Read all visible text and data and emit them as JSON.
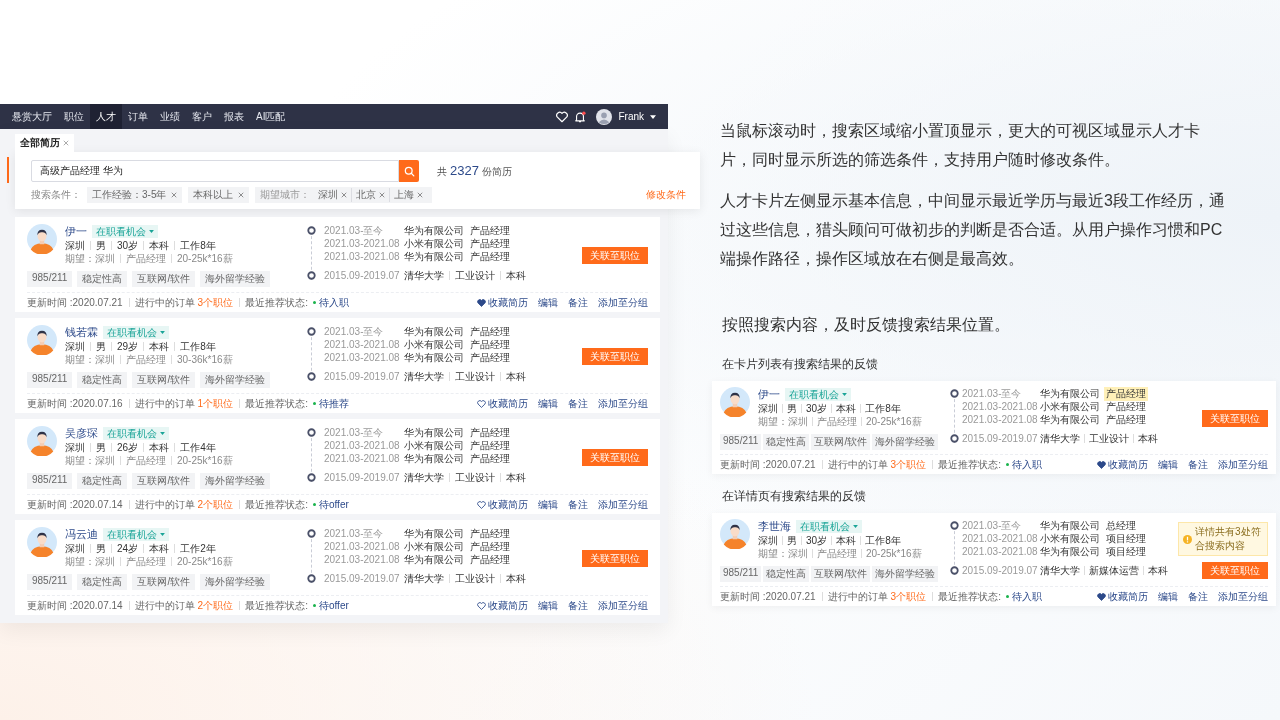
{
  "nav": {
    "items": [
      {
        "label": "悬赏大厅",
        "selected": false
      },
      {
        "label": "职位",
        "selected": false
      },
      {
        "label": "人才",
        "selected": true
      },
      {
        "label": "订单",
        "selected": false
      },
      {
        "label": "业绩",
        "selected": false
      },
      {
        "label": "客户",
        "selected": false
      },
      {
        "label": "报表",
        "selected": false
      },
      {
        "label": "AI匹配",
        "selected": false
      }
    ],
    "user": "Frank",
    "notification": true
  },
  "tabs": [
    {
      "label": "全部简历",
      "selected": true
    }
  ],
  "search": {
    "value": "高级产品经理 华为",
    "total_prefix": "共",
    "total": "2327",
    "total_suffix": "份简历",
    "conditions_label": "搜索条件：",
    "conditions": [
      {
        "kind": "chip",
        "label": "工作经验：3-5年"
      },
      {
        "kind": "chip",
        "label": "本科以上"
      },
      {
        "kind": "group",
        "label": "期望城市：",
        "values": [
          "深圳",
          "北京",
          "上海"
        ]
      }
    ],
    "modify": "修改条件"
  },
  "cards": [
    {
      "name": "伊一",
      "status": "在职看机会",
      "details": [
        "深圳",
        "男",
        "30岁",
        "本科",
        "工作8年"
      ],
      "expect_label": "期望：",
      "expect": [
        "深圳",
        "产品经理",
        "20-25k*16薪"
      ],
      "tags": [
        "985/211",
        "稳定性高",
        "互联网/软件",
        "海外留学经验"
      ],
      "jobs": [
        {
          "period": "2021.03-至今",
          "company": "华为有限公司",
          "title": "产品经理",
          "highlighted": false
        },
        {
          "period": "2021.03-2021.08",
          "company": "小米有限公司",
          "title": "产品经理",
          "highlighted": false
        },
        {
          "period": "2021.03-2021.08",
          "company": "华为有限公司",
          "title": "产品经理",
          "highlighted": false
        }
      ],
      "education": {
        "period": "2015.09-2019.07",
        "items": [
          "清华大学",
          "工业设计",
          "本科"
        ]
      },
      "action": "关联至职位",
      "updated": "更新时间 :2020.07.21",
      "orders_label": "进行中的订单",
      "orders": "3个职位",
      "recommend_label": "最近推荐状态:",
      "recommend": "待入职",
      "favorited": true,
      "links": [
        "收藏简历",
        "编辑",
        "备注",
        "添加至分组"
      ]
    },
    {
      "name": "钱若霖",
      "status": "在职看机会",
      "details": [
        "深圳",
        "男",
        "29岁",
        "本科",
        "工作8年"
      ],
      "expect_label": "期望：",
      "expect": [
        "深圳",
        "产品经理",
        "30-36k*16薪"
      ],
      "tags": [
        "985/211",
        "稳定性高",
        "互联网/软件",
        "海外留学经验"
      ],
      "jobs": [
        {
          "period": "2021.03-至今",
          "company": "华为有限公司",
          "title": "产品经理",
          "highlighted": false
        },
        {
          "period": "2021.03-2021.08",
          "company": "小米有限公司",
          "title": "产品经理",
          "highlighted": false
        },
        {
          "period": "2021.03-2021.08",
          "company": "华为有限公司",
          "title": "产品经理",
          "highlighted": false
        }
      ],
      "education": {
        "period": "2015.09-2019.07",
        "items": [
          "清华大学",
          "工业设计",
          "本科"
        ]
      },
      "action": "关联至职位",
      "updated": "更新时间 :2020.07.16",
      "orders_label": "进行中的订单",
      "orders": "1个职位",
      "recommend_label": "最近推荐状态:",
      "recommend": "待推荐",
      "favorited": false,
      "links": [
        "收藏简历",
        "编辑",
        "备注",
        "添加至分组"
      ]
    },
    {
      "name": "吴彦琛",
      "status": "在职看机会",
      "details": [
        "深圳",
        "男",
        "26岁",
        "本科",
        "工作4年"
      ],
      "expect_label": "期望：",
      "expect": [
        "深圳",
        "产品经理",
        "20-25k*16薪"
      ],
      "tags": [
        "985/211",
        "稳定性高",
        "互联网/软件",
        "海外留学经验"
      ],
      "jobs": [
        {
          "period": "2021.03-至今",
          "company": "华为有限公司",
          "title": "产品经理",
          "highlighted": false
        },
        {
          "period": "2021.03-2021.08",
          "company": "小米有限公司",
          "title": "产品经理",
          "highlighted": false
        },
        {
          "period": "2021.03-2021.08",
          "company": "华为有限公司",
          "title": "产品经理",
          "highlighted": false
        }
      ],
      "education": {
        "period": "2015.09-2019.07",
        "items": [
          "清华大学",
          "工业设计",
          "本科"
        ]
      },
      "action": "关联至职位",
      "updated": "更新时间 :2020.07.14",
      "orders_label": "进行中的订单",
      "orders": "2个职位",
      "recommend_label": "最近推荐状态:",
      "recommend": "待offer",
      "favorited": false,
      "links": [
        "收藏简历",
        "编辑",
        "备注",
        "添加至分组"
      ]
    },
    {
      "name": "冯云迪",
      "status": "在职看机会",
      "details": [
        "深圳",
        "男",
        "24岁",
        "本科",
        "工作2年"
      ],
      "expect_label": "期望：",
      "expect": [
        "深圳",
        "产品经理",
        "20-25k*16薪"
      ],
      "tags": [
        "985/211",
        "稳定性高",
        "互联网/软件",
        "海外留学经验"
      ],
      "jobs": [
        {
          "period": "2021.03-至今",
          "company": "华为有限公司",
          "title": "产品经理",
          "highlighted": false
        },
        {
          "period": "2021.03-2021.08",
          "company": "小米有限公司",
          "title": "产品经理",
          "highlighted": false
        },
        {
          "period": "2021.03-2021.08",
          "company": "华为有限公司",
          "title": "产品经理",
          "highlighted": false
        }
      ],
      "education": {
        "period": "2015.09-2019.07",
        "items": [
          "清华大学",
          "工业设计",
          "本科"
        ]
      },
      "action": "关联至职位",
      "updated": "更新时间 :2020.07.14",
      "orders_label": "进行中的订单",
      "orders": "2个职位",
      "recommend_label": "最近推荐状态:",
      "recommend": "待offer",
      "favorited": false,
      "links": [
        "收藏简历",
        "编辑",
        "备注",
        "添加至分组"
      ]
    }
  ],
  "description": [
    "当鼠标滚动时，搜索区域缩小置顶显示，更大的可视区域显示人才卡片，同时显示所选的筛选条件，支持用户随时修改条件。",
    "人才卡片左侧显示基本信息，中间显示最近学历与最近3段工作经历，通过这些信息，猎头顾问可做初步的判断是否合适。从用户操作习惯和PC端操作路径，操作区域放在右侧是最高效。"
  ],
  "feedback": {
    "heading": "按照搜索内容，及时反馈搜索结果位置。",
    "examples": [
      {
        "label": "在卡片列表有搜索结果的反馈",
        "card": {
          "name": "伊一",
          "status": "在职看机会",
          "details": [
            "深圳",
            "男",
            "30岁",
            "本科",
            "工作8年"
          ],
          "expect_label": "期望：",
          "expect": [
            "深圳",
            "产品经理",
            "20-25k*16薪"
          ],
          "tags": [
            "985/211",
            "稳定性高",
            "互联网/软件",
            "海外留学经验"
          ],
          "jobs": [
            {
              "period": "2021.03-至今",
              "company": "华为有限公司",
              "title": "产品经理",
              "highlighted": true
            },
            {
              "period": "2021.03-2021.08",
              "company": "小米有限公司",
              "title": "产品经理",
              "highlighted": false
            },
            {
              "period": "2021.03-2021.08",
              "company": "华为有限公司",
              "title": "产品经理",
              "highlighted": false
            }
          ],
          "education": {
            "period": "2015.09-2019.07",
            "items": [
              "清华大学",
              "工业设计",
              "本科"
            ]
          },
          "action": "关联至职位",
          "updated": "更新时间 :2020.07.21",
          "orders_label": "进行中的订单",
          "orders": "3个职位",
          "recommend_label": "最近推荐状态:",
          "recommend": "待入职",
          "favorited": true,
          "links": [
            "收藏简历",
            "编辑",
            "备注",
            "添加至分组"
          ]
        }
      },
      {
        "label": "在详情页有搜索结果的反馈",
        "card": {
          "name": "李世海",
          "status": "在职看机会",
          "details": [
            "深圳",
            "男",
            "30岁",
            "本科",
            "工作8年"
          ],
          "expect_label": "期望：",
          "expect": [
            "深圳",
            "产品经理",
            "20-25k*16薪"
          ],
          "tags": [
            "985/211",
            "稳定性高",
            "互联网/软件",
            "海外留学经验"
          ],
          "jobs": [
            {
              "period": "2021.03-至今",
              "company": "华为有限公司",
              "title": "总经理",
              "highlighted": false
            },
            {
              "period": "2021.03-2021.08",
              "company": "小米有限公司",
              "title": "项目经理",
              "highlighted": false
            },
            {
              "period": "2021.03-2021.08",
              "company": "华为有限公司",
              "title": "项目经理",
              "highlighted": false
            }
          ],
          "education": {
            "period": "2015.09-2019.07",
            "items": [
              "清华大学",
              "新媒体运营",
              "本科"
            ]
          },
          "notice": "详情共有3处符合搜索内容",
          "action": "关联至职位",
          "updated": "更新时间 :2020.07.21",
          "orders_label": "进行中的订单",
          "orders": "3个职位",
          "recommend_label": "最近推荐状态:",
          "recommend": "待入职",
          "favorited": true,
          "links": [
            "收藏简历",
            "编辑",
            "备注",
            "添加至分组"
          ]
        }
      }
    ]
  }
}
